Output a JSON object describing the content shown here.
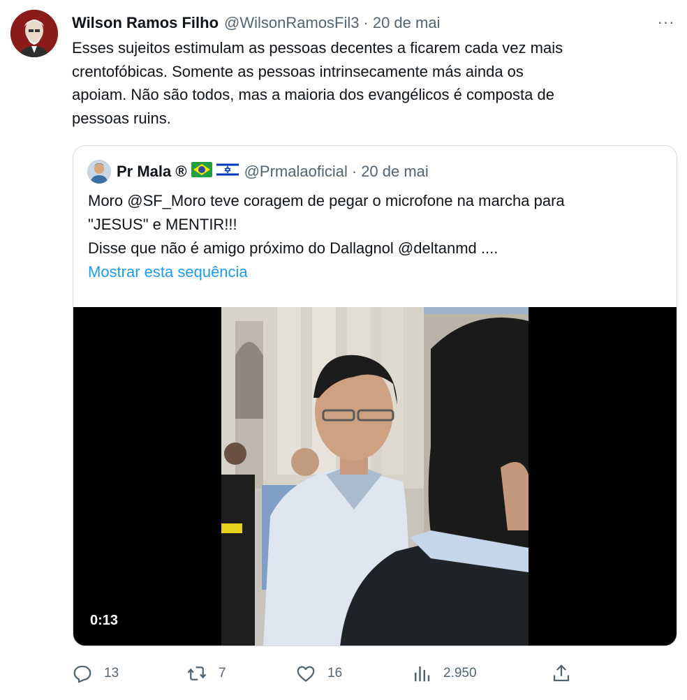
{
  "tweet": {
    "author_name": "Wilson Ramos Filho",
    "author_handle": "@WilsonRamosFil3",
    "separator": "·",
    "date": "20 de mai",
    "more_label": "···",
    "text_lines": [
      "Esses sujeitos estimulam as pessoas decentes a ficarem cada vez mais",
      "crentofóbicas. Somente as pessoas intrinsecamente más ainda os",
      "apoiam. Não são todos, mas a maioria dos evangélicos é composta de",
      "pessoas ruins."
    ]
  },
  "quote": {
    "author_name": "Pr Mala ®",
    "flags": [
      "brazil-flag",
      "israel-flag"
    ],
    "author_handle": "@Prmalaoficial",
    "separator": "·",
    "date": "20 de mai",
    "text_lines": [
      "Moro @SF_Moro teve coragem de pegar o microfone na marcha para",
      "\"JESUS\" e MENTIR!!!",
      "Disse que não é amigo próximo do Dallagnol @deltanmd ...."
    ],
    "show_thread_label": "Mostrar esta sequência",
    "video_duration": "0:13"
  },
  "actions": {
    "reply_count": "13",
    "retweet_count": "7",
    "like_count": "16",
    "views_count": "2.950"
  },
  "colors": {
    "text": "#0f1419",
    "secondary": "#536471",
    "link": "#1d9bf0",
    "border": "#cfd9de"
  }
}
